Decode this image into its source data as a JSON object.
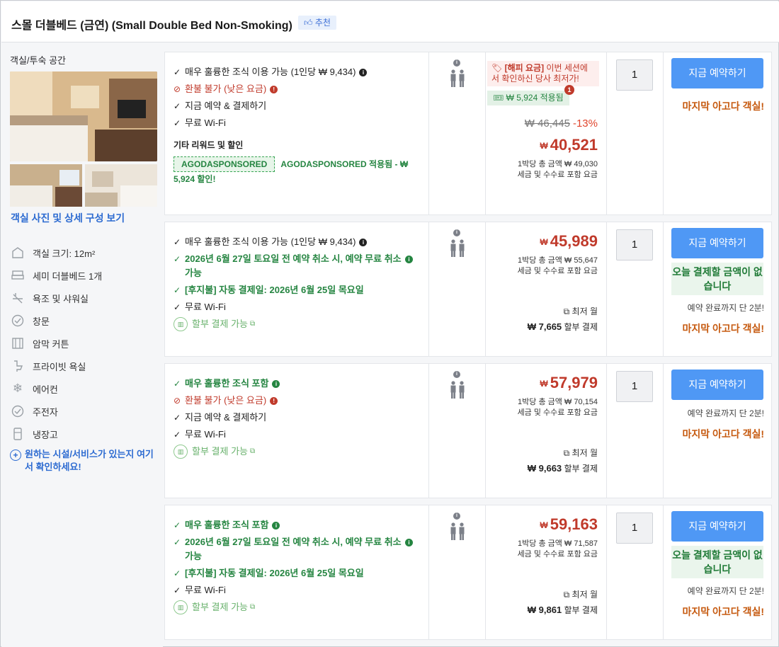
{
  "header": {
    "room_name": "스몰 더블베드 (금연) (Small Double Bed Non-Smoking)",
    "recommend_badge": "추천"
  },
  "left_panel": {
    "title": "객실/투숙 공간",
    "photo_link": "객실 사진 및 상세 구성 보기",
    "amenities": [
      {
        "label": "객실 크기: 12m²",
        "icon": "room-size-icon"
      },
      {
        "label": "세미 더블베드 1개",
        "icon": "bed-icon"
      },
      {
        "label": "욕조 및 샤워실",
        "icon": "bathtub-icon"
      },
      {
        "label": "창문",
        "icon": "window-icon"
      },
      {
        "label": "암막 커튼",
        "icon": "curtain-icon"
      },
      {
        "label": "프라이빗 욕실",
        "icon": "toilet-icon"
      },
      {
        "label": "에어컨",
        "icon": "snowflake-icon"
      },
      {
        "label": "주전자",
        "icon": "kettle-icon"
      },
      {
        "label": "냉장고",
        "icon": "fridge-icon"
      }
    ],
    "more_link": "원하는 시설/서비스가 있는지 여기서 확인하세요!"
  },
  "common": {
    "book_label": "지금 예약하기",
    "last_room": "마지막 아고다 객실!",
    "quantity": "1",
    "currency": "₩",
    "tax_note": "세금 및 수수료 포함 요금",
    "cheapest_month": "최저 월",
    "installment_suffix": "할부 결제",
    "no_pay_today": "오늘 결제할 금액이 없습니다",
    "two_min": "예약 완료까지 단 2분!"
  },
  "offers": [
    {
      "benefits": [
        {
          "text": "매우 훌륭한 조식 이용 가능 (1인당 ₩ 9,434)",
          "style": "normal",
          "mark": "✓",
          "dot": "blk"
        },
        {
          "text": "환불 불가 (낮은 요금)",
          "style": "red",
          "mark": "⊘",
          "dot": "red"
        },
        {
          "text": "지금 예약 & 결제하기",
          "style": "normal",
          "mark": "✓"
        },
        {
          "text": "무료 Wi-Fi",
          "style": "normal",
          "mark": "✓"
        }
      ],
      "promo_title": "기타 리워드 및 할인",
      "promo_code": "AGODASPONSORED",
      "promo_text": "AGODASPONSORED 적용됨 - ₩ 5,924 할인!",
      "happy_label": "[해피 요금]",
      "happy_text": "이번 세션에서 확인하신 당사 최저가!",
      "discount_badge": "₩ 5,924 적용됨",
      "discount_count": "1",
      "original_price": "₩ 46,445",
      "discount_pct": "-13%",
      "price": "40,521",
      "nightly": "1박당 총 금액 ₩ 49,030"
    },
    {
      "benefits": [
        {
          "text": "매우 훌륭한 조식 이용 가능 (1인당 ₩ 9,434)",
          "style": "normal",
          "mark": "✓",
          "dot": "blk"
        },
        {
          "text": "2026년 6월 27일 토요일 전 예약 취소 시, 예약 무료 취소 가능",
          "style": "green",
          "mark": "✓",
          "dot": "grn"
        },
        {
          "text": "[후지불] 자동 결제일: 2026년 6월 25일 목요일",
          "style": "green",
          "mark": "✓"
        },
        {
          "text": "무료 Wi-Fi",
          "style": "normal",
          "mark": "✓"
        }
      ],
      "pay_later": "할부 결제 가능",
      "price": "45,989",
      "nightly": "1박당 총 금액 ₩ 55,647",
      "installment": "₩ 7,665"
    },
    {
      "benefits": [
        {
          "text": "매우 훌륭한 조식 포함",
          "style": "green",
          "mark": "✓",
          "dot": "grn"
        },
        {
          "text": "환불 불가 (낮은 요금)",
          "style": "red",
          "mark": "⊘",
          "dot": "red"
        },
        {
          "text": "지금 예약 & 결제하기",
          "style": "normal",
          "mark": "✓"
        },
        {
          "text": "무료 Wi-Fi",
          "style": "normal",
          "mark": "✓"
        }
      ],
      "pay_later": "할부 결제 가능",
      "price": "57,979",
      "nightly": "1박당 총 금액 ₩ 70,154",
      "installment": "₩ 9,663"
    },
    {
      "benefits": [
        {
          "text": "매우 훌륭한 조식 포함",
          "style": "green",
          "mark": "✓",
          "dot": "grn"
        },
        {
          "text": "2026년 6월 27일 토요일 전 예약 취소 시, 예약 무료 취소 가능",
          "style": "green",
          "mark": "✓",
          "dot": "grn"
        },
        {
          "text": "[후지불] 자동 결제일: 2026년 6월 25일 목요일",
          "style": "green",
          "mark": "✓"
        },
        {
          "text": "무료 Wi-Fi",
          "style": "normal",
          "mark": "✓"
        }
      ],
      "pay_later": "할부 결제 가능",
      "price": "59,163",
      "nightly": "1박당 총 금액 ₩ 71,587",
      "installment": "₩ 9,861"
    }
  ]
}
